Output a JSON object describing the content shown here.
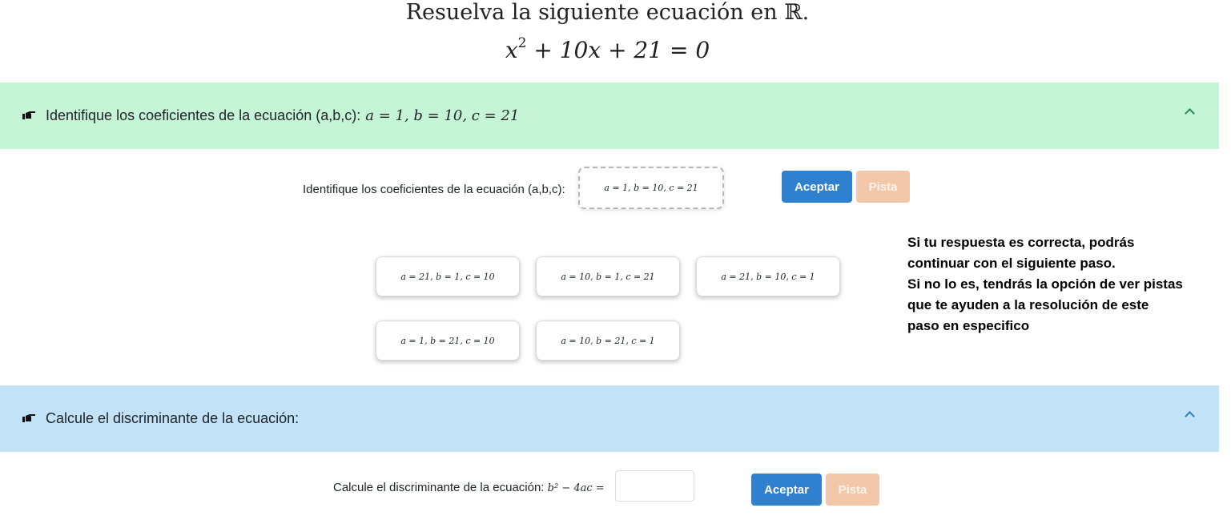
{
  "header": {
    "title": "Resuelva la siguiente ecuación en ℝ.",
    "equation_main": "x",
    "equation_exp": "2",
    "equation_rest": " + 10x + 21 = 0"
  },
  "step1": {
    "header_label": "Identifique los coeficientes de la ecuación (a,b,c):",
    "header_answer": "a = 1, b = 10, c = 21",
    "prompt": "Identifique los coeficientes de la ecuación (a,b,c):",
    "answer_value": "a = 1, b = 10, c = 21",
    "accept_label": "Aceptar",
    "hint_label": "Pista",
    "options": [
      "a = 21, b = 1, c = 10",
      "a = 10, b = 1, c = 21",
      "a = 21, b = 10, c = 1",
      "a = 1, b = 21, c = 10",
      "a = 10, b = 21, c = 1"
    ]
  },
  "note": {
    "line1": "Si tu respuesta es correcta, podrás\ncontinuar con el siguiente paso.",
    "line2": "Si no lo es, tendrás la opción de ver pistas\nque te ayuden a la resolución de este\npaso en especifico"
  },
  "step2": {
    "header_label": "Calcule el discriminante de la ecuación:",
    "prompt": "Calcule el discriminante de la ecuación:",
    "formula": "b² − 4ac =",
    "input_value": "",
    "accept_label": "Aceptar",
    "hint_label": "Pista"
  },
  "icons": {
    "hand": "pointing-hand-icon",
    "chevron": "chevron-up-icon"
  }
}
